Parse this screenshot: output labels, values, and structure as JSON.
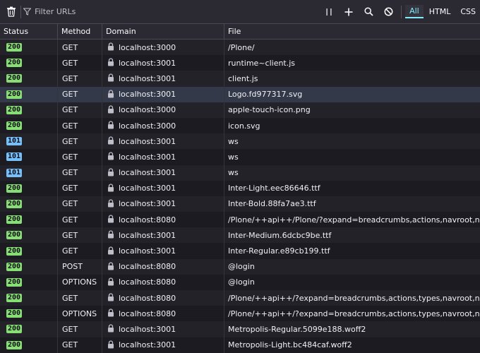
{
  "toolbar": {
    "filter_placeholder": "Filter URLs",
    "type_filters": [
      "All",
      "HTML",
      "CSS"
    ],
    "active_filter": "All"
  },
  "columns": {
    "status": "Status",
    "method": "Method",
    "domain": "Domain",
    "file": "File"
  },
  "colors": {
    "status_200": "#86de74",
    "status_101": "#75bfff"
  },
  "requests": [
    {
      "status": "200",
      "method": "GET",
      "domain": "localhost:3000",
      "file": "/Plone/"
    },
    {
      "status": "200",
      "method": "GET",
      "domain": "localhost:3001",
      "file": "runtime~client.js"
    },
    {
      "status": "200",
      "method": "GET",
      "domain": "localhost:3001",
      "file": "client.js"
    },
    {
      "status": "200",
      "method": "GET",
      "domain": "localhost:3001",
      "file": "Logo.fd977317.svg",
      "selected": true
    },
    {
      "status": "200",
      "method": "GET",
      "domain": "localhost:3000",
      "file": "apple-touch-icon.png"
    },
    {
      "status": "200",
      "method": "GET",
      "domain": "localhost:3000",
      "file": "icon.svg"
    },
    {
      "status": "101",
      "method": "GET",
      "domain": "localhost:3001",
      "file": "ws"
    },
    {
      "status": "101",
      "method": "GET",
      "domain": "localhost:3001",
      "file": "ws"
    },
    {
      "status": "101",
      "method": "GET",
      "domain": "localhost:3001",
      "file": "ws"
    },
    {
      "status": "200",
      "method": "GET",
      "domain": "localhost:3001",
      "file": "Inter-Light.eec86646.ttf"
    },
    {
      "status": "200",
      "method": "GET",
      "domain": "localhost:3001",
      "file": "Inter-Bold.88fa7ae3.ttf"
    },
    {
      "status": "200",
      "method": "GET",
      "domain": "localhost:8080",
      "file": "/Plone/++api++/Plone/?expand=breadcrumbs,actions,navroot,navigation,in"
    },
    {
      "status": "200",
      "method": "GET",
      "domain": "localhost:3001",
      "file": "Inter-Medium.6dcbc9be.ttf"
    },
    {
      "status": "200",
      "method": "GET",
      "domain": "localhost:3001",
      "file": "Inter-Regular.e89cb199.ttf"
    },
    {
      "status": "200",
      "method": "POST",
      "domain": "localhost:8080",
      "file": "@login"
    },
    {
      "status": "200",
      "method": "OPTIONS",
      "domain": "localhost:8080",
      "file": "@login"
    },
    {
      "status": "200",
      "method": "GET",
      "domain": "localhost:8080",
      "file": "/Plone/++api++/?expand=breadcrumbs,actions,types,navroot,navigation,in"
    },
    {
      "status": "200",
      "method": "OPTIONS",
      "domain": "localhost:8080",
      "file": "/Plone/++api++/?expand=breadcrumbs,actions,types,navroot,navigation,in"
    },
    {
      "status": "200",
      "method": "GET",
      "domain": "localhost:3001",
      "file": "Metropolis-Regular.5099e188.woff2"
    },
    {
      "status": "200",
      "method": "GET",
      "domain": "localhost:3001",
      "file": "Metropolis-Light.bc484caf.woff2"
    }
  ]
}
